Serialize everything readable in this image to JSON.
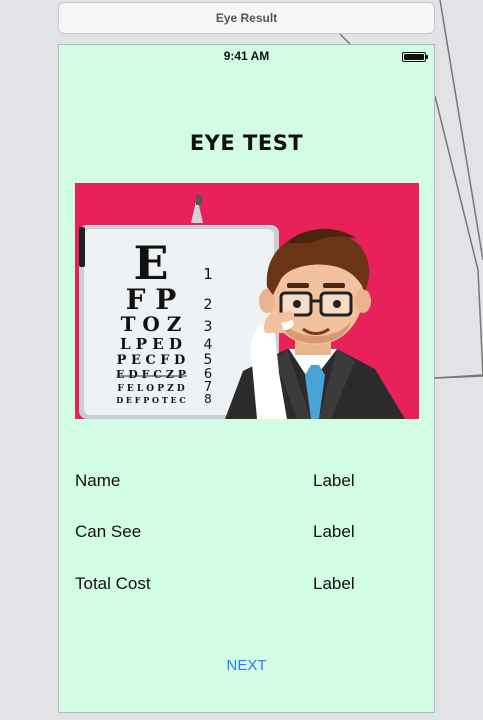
{
  "scene": {
    "title": "Eye Result"
  },
  "status_bar": {
    "time": "9:41 AM",
    "battery_icon": "battery-full-icon"
  },
  "screen": {
    "title": "EYE TEST",
    "background_color": "#d2fce4",
    "hero_image": {
      "background_color": "#e8215a",
      "chart_rows": [
        {
          "letters": "E",
          "number": "1"
        },
        {
          "letters": "F P",
          "number": "2"
        },
        {
          "letters": "T O Z",
          "number": "3"
        },
        {
          "letters": "L P E D",
          "number": "4"
        },
        {
          "letters": "P E C F D",
          "number": "5"
        },
        {
          "letters": "E D F C Z P",
          "number": "6"
        },
        {
          "letters": "F E L O P Z D",
          "number": "7"
        },
        {
          "letters": "D E F P O T E C",
          "number": "8"
        }
      ]
    },
    "fields": [
      {
        "label": "Name",
        "value": "Label"
      },
      {
        "label": "Can See",
        "value": "Label"
      },
      {
        "label": "Total Cost",
        "value": "Label"
      }
    ],
    "next_label": "NEXT",
    "accent_color": "#2f7cf6"
  }
}
